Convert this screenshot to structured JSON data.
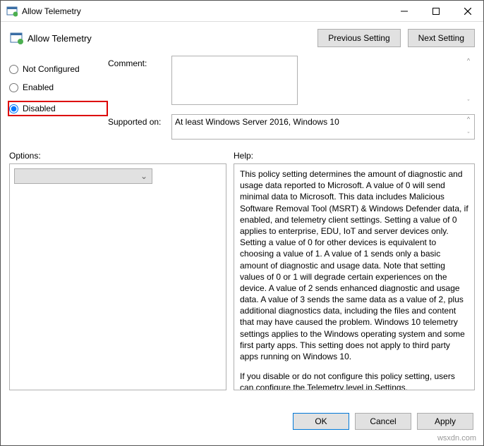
{
  "window": {
    "title": "Allow Telemetry"
  },
  "header": {
    "title": "Allow Telemetry",
    "prev_label": "Previous Setting",
    "next_label": "Next Setting"
  },
  "radios": {
    "not_configured": "Not Configured",
    "enabled": "Enabled",
    "disabled": "Disabled",
    "selected": "disabled"
  },
  "fields": {
    "comment_label": "Comment:",
    "comment_value": "",
    "supported_label": "Supported on:",
    "supported_value": "At least Windows Server 2016, Windows 10"
  },
  "sections": {
    "options_label": "Options:",
    "help_label": "Help:"
  },
  "help": {
    "p1": "This policy setting determines the amount of diagnostic and usage data reported to Microsoft. A value of 0 will send minimal data to Microsoft. This data includes Malicious Software Removal Tool (MSRT) & Windows Defender data, if enabled, and telemetry client settings. Setting a value of 0 applies to enterprise, EDU, IoT and server devices only. Setting a value of 0 for other devices is equivalent to choosing a value of 1. A value of 1 sends only a basic amount of diagnostic and usage data. Note that setting values of 0 or 1 will degrade certain experiences on the device. A value of 2 sends enhanced diagnostic and usage data. A value of 3 sends the same data as a value of 2, plus additional diagnostics data, including the files and content that may have caused the problem. Windows 10 telemetry settings applies to the Windows operating system and some first party apps. This setting does not apply to third party apps running on Windows 10.",
    "p2": "If you disable or do not configure this policy setting, users can configure the Telemetry level in Settings."
  },
  "buttons": {
    "ok": "OK",
    "cancel": "Cancel",
    "apply": "Apply"
  },
  "watermark": "wsxdn.com"
}
